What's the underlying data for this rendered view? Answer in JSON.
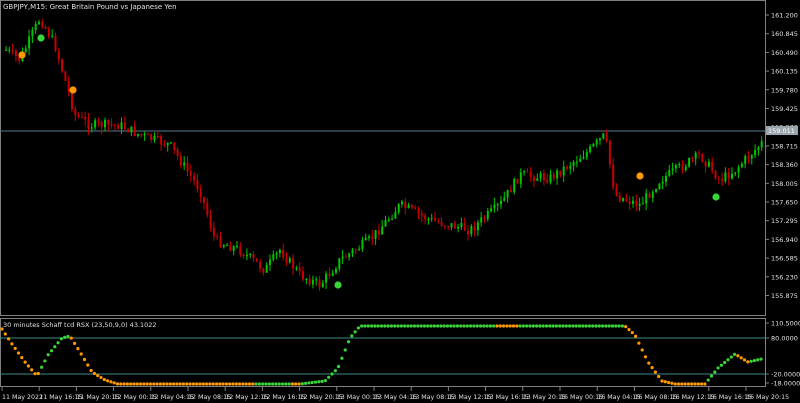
{
  "main": {
    "symbol_label": "GBPJPY,M15:  Great Britain Pound vs Japanese Yen",
    "price_ticks": [
      "161.200",
      "160.845",
      "160.490",
      "160.135",
      "159.780",
      "159.425",
      "159.070",
      "158.715",
      "158.360",
      "158.005",
      "157.650",
      "157.295",
      "156.940",
      "156.585",
      "156.230",
      "155.875"
    ],
    "current_price": "159.011",
    "colors": {
      "bull": "#00c800",
      "bear": "#c80000",
      "buy_dot": "#39d439",
      "sell_dot": "#ff9900",
      "line": "#5a7a8a"
    }
  },
  "indicator": {
    "label": "30 minutes Schaff tcd RSX (23,50,9,0) 43.1022",
    "ticks": [
      "110.5000",
      "80.0000",
      "-20.0000",
      "-18.0000"
    ]
  },
  "time_axis": [
    "11 May 2022",
    "11 May 16:15",
    "11 May 20:15",
    "12 May 00:15",
    "12 May 04:15",
    "12 May 08:15",
    "12 May 12:15",
    "12 May 16:15",
    "12 May 20:15",
    "13 May 00:15",
    "13 May 04:15",
    "13 May 08:15",
    "13 May 12:15",
    "13 May 16:15",
    "13 May 20:15",
    "16 May 00:15",
    "16 May 04:15",
    "16 May 08:15",
    "16 May 12:15",
    "16 May 16:15",
    "16 May 20:15"
  ]
}
